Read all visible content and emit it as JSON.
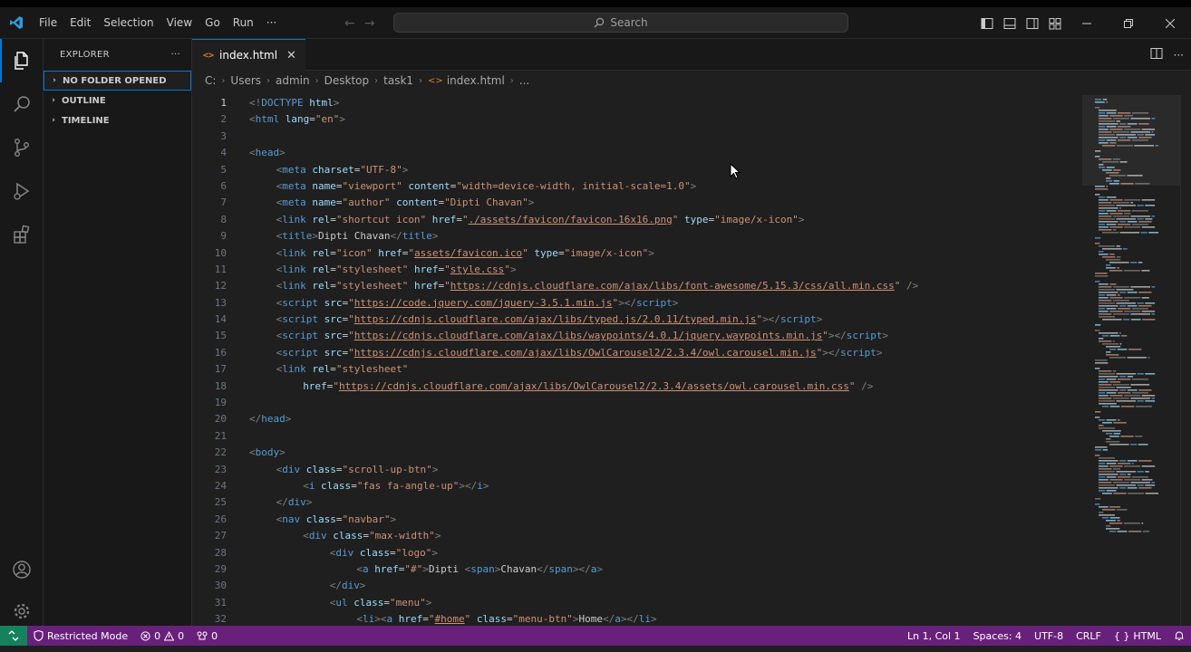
{
  "window": {
    "menu": [
      "File",
      "Edit",
      "Selection",
      "View",
      "Go",
      "Run",
      "···"
    ],
    "search_label": "Search"
  },
  "sidebar": {
    "title": "EXPLORER",
    "more": "···",
    "sections": [
      {
        "label": "NO FOLDER OPENED",
        "focused": true
      },
      {
        "label": "OUTLINE",
        "focused": false
      },
      {
        "label": "TIMELINE",
        "focused": false
      }
    ]
  },
  "editor": {
    "tab": {
      "label": "index.html",
      "icon": "<>"
    },
    "breadcrumb": [
      "C:",
      "Users",
      "admin",
      "Desktop",
      "task1",
      "index.html",
      "..."
    ],
    "active_line": 1,
    "lines": [
      {
        "n": 1,
        "i": 0,
        "tok": [
          [
            "p",
            "<!"
          ],
          [
            "t",
            "DOCTYPE"
          ],
          [
            "a",
            " html"
          ],
          [
            "p",
            ">"
          ]
        ]
      },
      {
        "n": 2,
        "i": 0,
        "tok": [
          [
            "p",
            "<"
          ],
          [
            "t",
            "html"
          ],
          [
            "a",
            " lang"
          ],
          [
            "x",
            "="
          ],
          [
            "v",
            "\"en\""
          ],
          [
            "p",
            ">"
          ]
        ]
      },
      {
        "n": 3,
        "i": 0,
        "tok": []
      },
      {
        "n": 4,
        "i": 0,
        "tok": [
          [
            "p",
            "<"
          ],
          [
            "t",
            "head"
          ],
          [
            "p",
            ">"
          ]
        ]
      },
      {
        "n": 5,
        "i": 1,
        "tok": [
          [
            "p",
            "<"
          ],
          [
            "t",
            "meta"
          ],
          [
            "a",
            " charset"
          ],
          [
            "x",
            "="
          ],
          [
            "v",
            "\"UTF-8\""
          ],
          [
            "p",
            ">"
          ]
        ]
      },
      {
        "n": 6,
        "i": 1,
        "tok": [
          [
            "p",
            "<"
          ],
          [
            "t",
            "meta"
          ],
          [
            "a",
            " name"
          ],
          [
            "x",
            "="
          ],
          [
            "v",
            "\"viewport\""
          ],
          [
            "a",
            " content"
          ],
          [
            "x",
            "="
          ],
          [
            "v",
            "\"width=device-width, initial-scale=1.0\""
          ],
          [
            "p",
            ">"
          ]
        ]
      },
      {
        "n": 7,
        "i": 1,
        "tok": [
          [
            "p",
            "<"
          ],
          [
            "t",
            "meta"
          ],
          [
            "a",
            " name"
          ],
          [
            "x",
            "="
          ],
          [
            "v",
            "\"author\""
          ],
          [
            "a",
            " content"
          ],
          [
            "x",
            "="
          ],
          [
            "v",
            "\"Dipti Chavan\""
          ],
          [
            "p",
            ">"
          ]
        ]
      },
      {
        "n": 8,
        "i": 1,
        "tok": [
          [
            "p",
            "<"
          ],
          [
            "t",
            "link"
          ],
          [
            "a",
            " rel"
          ],
          [
            "x",
            "="
          ],
          [
            "v",
            "\"shortcut icon\""
          ],
          [
            "a",
            " href"
          ],
          [
            "x",
            "="
          ],
          [
            "v",
            "\""
          ],
          [
            "u",
            "./assets/favicon/favicon-16x16.png"
          ],
          [
            "v",
            "\""
          ],
          [
            "a",
            " type"
          ],
          [
            "x",
            "="
          ],
          [
            "v",
            "\"image/x-icon\""
          ],
          [
            "p",
            ">"
          ]
        ]
      },
      {
        "n": 9,
        "i": 1,
        "tok": [
          [
            "p",
            "<"
          ],
          [
            "t",
            "title"
          ],
          [
            "p",
            ">"
          ],
          [
            "x",
            "Dipti Chavan"
          ],
          [
            "p",
            "</"
          ],
          [
            "t",
            "title"
          ],
          [
            "p",
            ">"
          ]
        ]
      },
      {
        "n": 10,
        "i": 1,
        "tok": [
          [
            "p",
            "<"
          ],
          [
            "t",
            "link"
          ],
          [
            "a",
            " rel"
          ],
          [
            "x",
            "="
          ],
          [
            "v",
            "\"icon\""
          ],
          [
            "a",
            " href"
          ],
          [
            "x",
            "="
          ],
          [
            "v",
            "\""
          ],
          [
            "u",
            "assets/favicon.ico"
          ],
          [
            "v",
            "\""
          ],
          [
            "a",
            " type"
          ],
          [
            "x",
            "="
          ],
          [
            "v",
            "\"image/x-icon\""
          ],
          [
            "p",
            ">"
          ]
        ]
      },
      {
        "n": 11,
        "i": 1,
        "tok": [
          [
            "p",
            "<"
          ],
          [
            "t",
            "link"
          ],
          [
            "a",
            " rel"
          ],
          [
            "x",
            "="
          ],
          [
            "v",
            "\"stylesheet\""
          ],
          [
            "a",
            " href"
          ],
          [
            "x",
            "="
          ],
          [
            "v",
            "\""
          ],
          [
            "u",
            "style.css"
          ],
          [
            "v",
            "\""
          ],
          [
            "p",
            ">"
          ]
        ]
      },
      {
        "n": 12,
        "i": 1,
        "tok": [
          [
            "p",
            "<"
          ],
          [
            "t",
            "link"
          ],
          [
            "a",
            " rel"
          ],
          [
            "x",
            "="
          ],
          [
            "v",
            "\"stylesheet\""
          ],
          [
            "a",
            " href"
          ],
          [
            "x",
            "="
          ],
          [
            "v",
            "\""
          ],
          [
            "u",
            "https://cdnjs.cloudflare.com/ajax/libs/font-awesome/5.15.3/css/all.min.css"
          ],
          [
            "v",
            "\""
          ],
          [
            "p",
            " />"
          ]
        ]
      },
      {
        "n": 13,
        "i": 1,
        "tok": [
          [
            "p",
            "<"
          ],
          [
            "t",
            "script"
          ],
          [
            "a",
            " src"
          ],
          [
            "x",
            "="
          ],
          [
            "v",
            "\""
          ],
          [
            "u",
            "https://code.jquery.com/jquery-3.5.1.min.js"
          ],
          [
            "v",
            "\""
          ],
          [
            "p",
            "></"
          ],
          [
            "t",
            "script"
          ],
          [
            "p",
            ">"
          ]
        ]
      },
      {
        "n": 14,
        "i": 1,
        "tok": [
          [
            "p",
            "<"
          ],
          [
            "t",
            "script"
          ],
          [
            "a",
            " src"
          ],
          [
            "x",
            "="
          ],
          [
            "v",
            "\""
          ],
          [
            "u",
            "https://cdnjs.cloudflare.com/ajax/libs/typed.js/2.0.11/typed.min.js"
          ],
          [
            "v",
            "\""
          ],
          [
            "p",
            "></"
          ],
          [
            "t",
            "script"
          ],
          [
            "p",
            ">"
          ]
        ]
      },
      {
        "n": 15,
        "i": 1,
        "tok": [
          [
            "p",
            "<"
          ],
          [
            "t",
            "script"
          ],
          [
            "a",
            " src"
          ],
          [
            "x",
            "="
          ],
          [
            "v",
            "\""
          ],
          [
            "u",
            "https://cdnjs.cloudflare.com/ajax/libs/waypoints/4.0.1/jquery.waypoints.min.js"
          ],
          [
            "v",
            "\""
          ],
          [
            "p",
            "></"
          ],
          [
            "t",
            "script"
          ],
          [
            "p",
            ">"
          ]
        ]
      },
      {
        "n": 16,
        "i": 1,
        "tok": [
          [
            "p",
            "<"
          ],
          [
            "t",
            "script"
          ],
          [
            "a",
            " src"
          ],
          [
            "x",
            "="
          ],
          [
            "v",
            "\""
          ],
          [
            "u",
            "https://cdnjs.cloudflare.com/ajax/libs/OwlCarousel2/2.3.4/owl.carousel.min.js"
          ],
          [
            "v",
            "\""
          ],
          [
            "p",
            "></"
          ],
          [
            "t",
            "script"
          ],
          [
            "p",
            ">"
          ]
        ]
      },
      {
        "n": 17,
        "i": 1,
        "tok": [
          [
            "p",
            "<"
          ],
          [
            "t",
            "link"
          ],
          [
            "a",
            " rel"
          ],
          [
            "x",
            "="
          ],
          [
            "v",
            "\"stylesheet\""
          ]
        ]
      },
      {
        "n": 18,
        "i": 2,
        "tok": [
          [
            "a",
            "href"
          ],
          [
            "x",
            "="
          ],
          [
            "v",
            "\""
          ],
          [
            "u",
            "https://cdnjs.cloudflare.com/ajax/libs/OwlCarousel2/2.3.4/assets/owl.carousel.min.css"
          ],
          [
            "v",
            "\""
          ],
          [
            "p",
            " />"
          ]
        ]
      },
      {
        "n": 19,
        "i": 0,
        "tok": []
      },
      {
        "n": 20,
        "i": 0,
        "tok": [
          [
            "p",
            "</"
          ],
          [
            "t",
            "head"
          ],
          [
            "p",
            ">"
          ]
        ]
      },
      {
        "n": 21,
        "i": 0,
        "tok": []
      },
      {
        "n": 22,
        "i": 0,
        "tok": [
          [
            "p",
            "<"
          ],
          [
            "t",
            "body"
          ],
          [
            "p",
            ">"
          ]
        ]
      },
      {
        "n": 23,
        "i": 1,
        "tok": [
          [
            "p",
            "<"
          ],
          [
            "t",
            "div"
          ],
          [
            "a",
            " class"
          ],
          [
            "x",
            "="
          ],
          [
            "v",
            "\"scroll-up-btn\""
          ],
          [
            "p",
            ">"
          ]
        ]
      },
      {
        "n": 24,
        "i": 2,
        "tok": [
          [
            "p",
            "<"
          ],
          [
            "t",
            "i"
          ],
          [
            "a",
            " class"
          ],
          [
            "x",
            "="
          ],
          [
            "v",
            "\"fas fa-angle-up\""
          ],
          [
            "p",
            "></"
          ],
          [
            "t",
            "i"
          ],
          [
            "p",
            ">"
          ]
        ]
      },
      {
        "n": 25,
        "i": 1,
        "tok": [
          [
            "p",
            "</"
          ],
          [
            "t",
            "div"
          ],
          [
            "p",
            ">"
          ]
        ]
      },
      {
        "n": 26,
        "i": 1,
        "tok": [
          [
            "p",
            "<"
          ],
          [
            "t",
            "nav"
          ],
          [
            "a",
            " class"
          ],
          [
            "x",
            "="
          ],
          [
            "v",
            "\"navbar\""
          ],
          [
            "p",
            ">"
          ]
        ]
      },
      {
        "n": 27,
        "i": 2,
        "tok": [
          [
            "p",
            "<"
          ],
          [
            "t",
            "div"
          ],
          [
            "a",
            " class"
          ],
          [
            "x",
            "="
          ],
          [
            "v",
            "\"max-width\""
          ],
          [
            "p",
            ">"
          ]
        ]
      },
      {
        "n": 28,
        "i": 3,
        "tok": [
          [
            "p",
            "<"
          ],
          [
            "t",
            "div"
          ],
          [
            "a",
            " class"
          ],
          [
            "x",
            "="
          ],
          [
            "v",
            "\"logo\""
          ],
          [
            "p",
            ">"
          ]
        ]
      },
      {
        "n": 29,
        "i": 4,
        "tok": [
          [
            "p",
            "<"
          ],
          [
            "t",
            "a"
          ],
          [
            "a",
            " href"
          ],
          [
            "x",
            "="
          ],
          [
            "v",
            "\"#\""
          ],
          [
            "p",
            ">"
          ],
          [
            "x",
            "Dipti "
          ],
          [
            "p",
            "<"
          ],
          [
            "t",
            "span"
          ],
          [
            "p",
            ">"
          ],
          [
            "x",
            "Chavan"
          ],
          [
            "p",
            "</"
          ],
          [
            "t",
            "span"
          ],
          [
            "p",
            "></"
          ],
          [
            "t",
            "a"
          ],
          [
            "p",
            ">"
          ]
        ]
      },
      {
        "n": 30,
        "i": 3,
        "tok": [
          [
            "p",
            "</"
          ],
          [
            "t",
            "div"
          ],
          [
            "p",
            ">"
          ]
        ]
      },
      {
        "n": 31,
        "i": 3,
        "tok": [
          [
            "p",
            "<"
          ],
          [
            "t",
            "ul"
          ],
          [
            "a",
            " class"
          ],
          [
            "x",
            "="
          ],
          [
            "v",
            "\"menu\""
          ],
          [
            "p",
            ">"
          ]
        ]
      },
      {
        "n": 32,
        "i": 4,
        "tok": [
          [
            "p",
            "<"
          ],
          [
            "t",
            "li"
          ],
          [
            "p",
            "><"
          ],
          [
            "t",
            "a"
          ],
          [
            "a",
            " href"
          ],
          [
            "x",
            "="
          ],
          [
            "v",
            "\""
          ],
          [
            "u",
            "#home"
          ],
          [
            "v",
            "\""
          ],
          [
            "a",
            " class"
          ],
          [
            "x",
            "="
          ],
          [
            "v",
            "\"menu-btn\""
          ],
          [
            "p",
            ">"
          ],
          [
            "x",
            "Home"
          ],
          [
            "p",
            "</"
          ],
          [
            "t",
            "a"
          ],
          [
            "p",
            "></"
          ],
          [
            "t",
            "li"
          ],
          [
            "p",
            ">"
          ]
        ]
      }
    ]
  },
  "statusbar": {
    "restricted_mode": "Restricted Mode",
    "errors": "0",
    "warnings": "0",
    "ports": "0",
    "cursor": "Ln 1, Col 1",
    "spaces": "Spaces: 4",
    "encoding": "UTF-8",
    "eol": "CRLF",
    "language": "HTML"
  },
  "colors": {
    "accent": "#0078d4",
    "statusbar": "#68217a",
    "remote": "#16825d"
  }
}
